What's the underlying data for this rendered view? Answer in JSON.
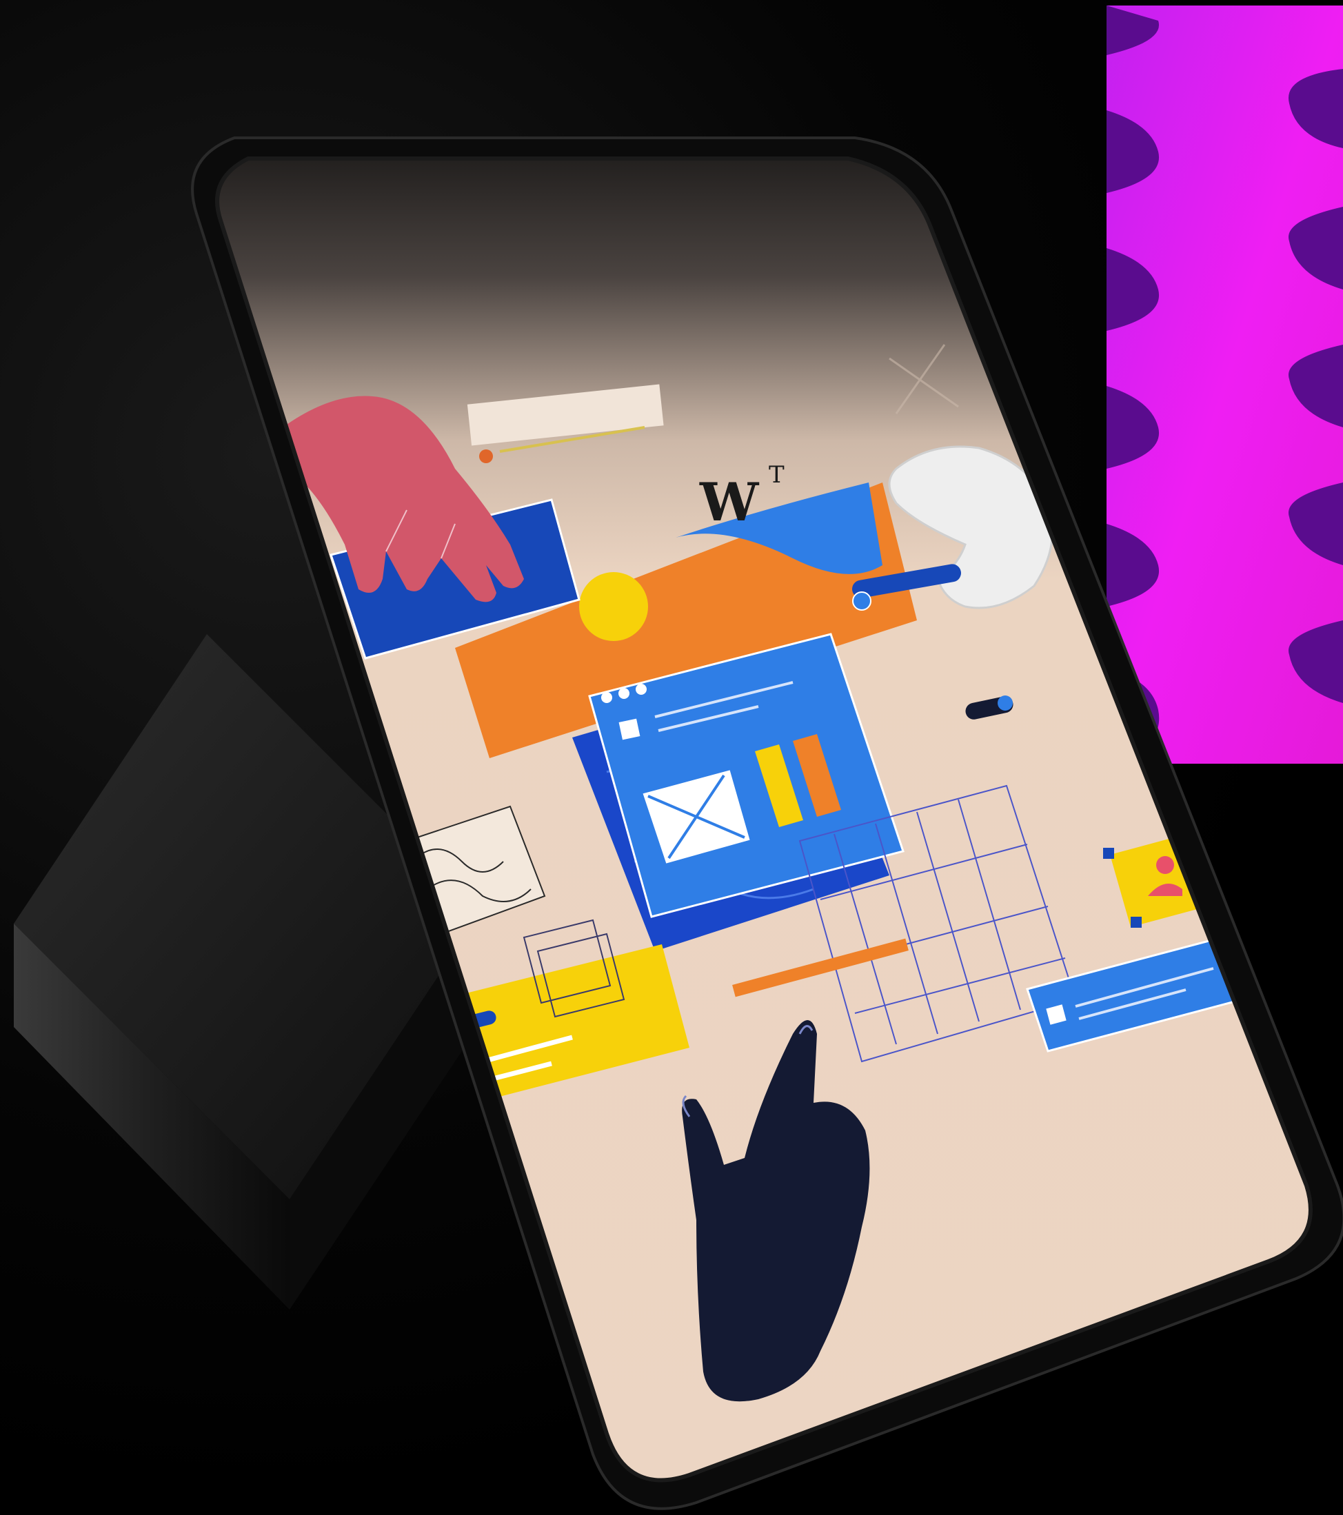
{
  "scene": {
    "description_colors": {
      "background": "#000000",
      "pedestal": "#1b1b1b",
      "phone_frame": "#0a0a0a",
      "screen_beige": "#ecd5c3",
      "screen_top_fade": "#2a2522",
      "orange": "#ef8129",
      "blue": "#2f7ee6",
      "dark_blue": "#1748b8",
      "yellow": "#f7d10a",
      "pink_hand": "#d2576a",
      "navy_hand": "#141a33",
      "magenta": "#e21df2",
      "purple": "#7a12b8"
    },
    "logo_letter": "W",
    "logo_superscript": "T"
  }
}
